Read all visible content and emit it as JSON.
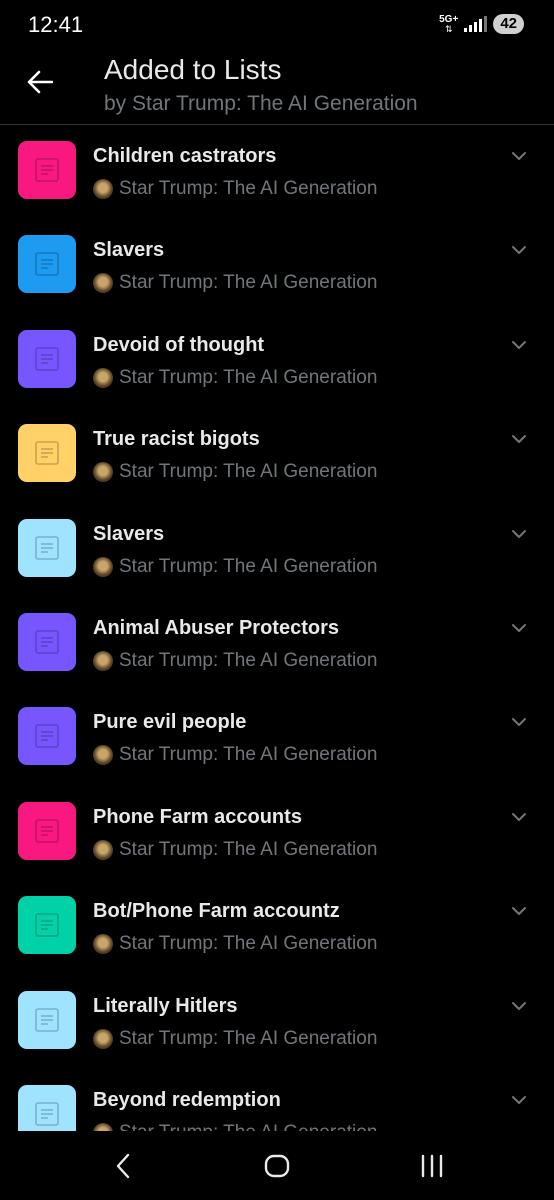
{
  "status_bar": {
    "time": "12:41",
    "network": "5G+",
    "battery": "42"
  },
  "header": {
    "title": "Added to Lists",
    "subtitle": "by Star Trump: The AI Generation",
    "back_icon": "arrow-left-icon"
  },
  "lists": [
    {
      "name": "Children castrators",
      "owner": "Star Trump: The AI Generation",
      "color": "#f91880"
    },
    {
      "name": "Slavers",
      "owner": "Star Trump: The AI Generation",
      "color": "#1d9bf0"
    },
    {
      "name": "Devoid of thought",
      "owner": "Star Trump: The AI Generation",
      "color": "#7856ff"
    },
    {
      "name": "True racist bigots",
      "owner": "Star Trump: The AI Generation",
      "color": "#ffd166"
    },
    {
      "name": "Slavers",
      "owner": "Star Trump: The AI Generation",
      "color": "#9fe3ff"
    },
    {
      "name": "Animal Abuser Protectors",
      "owner": "Star Trump: The AI Generation",
      "color": "#7856ff"
    },
    {
      "name": "Pure evil people",
      "owner": "Star Trump: The AI Generation",
      "color": "#7856ff"
    },
    {
      "name": "Phone Farm accounts",
      "owner": "Star Trump: The AI Generation",
      "color": "#f91880"
    },
    {
      "name": "Bot/Phone Farm accountz",
      "owner": "Star Trump: The AI Generation",
      "color": "#00d1a7"
    },
    {
      "name": "Literally Hitlers",
      "owner": "Star Trump: The AI Generation",
      "color": "#9fe3ff"
    },
    {
      "name": "Beyond redemption",
      "owner": "Star Trump: The AI Generation",
      "color": "#9fe3ff"
    }
  ],
  "nav_bar": {
    "back_icon": "nav-back-icon",
    "home_icon": "nav-home-icon",
    "recents_icon": "nav-recents-icon"
  }
}
